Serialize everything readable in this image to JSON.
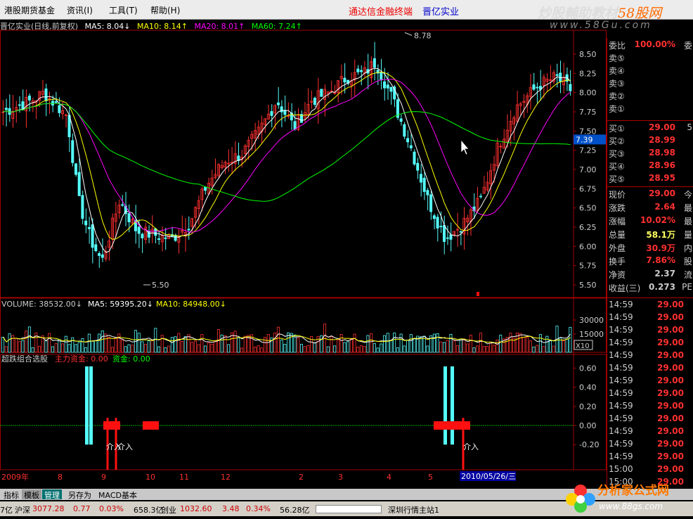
{
  "menubar": {
    "items": [
      "港股期货基金",
      "资讯(I)",
      "工具(T)",
      "帮助(H)"
    ],
    "promo": "通达信金融终端",
    "stock": "晋亿实业"
  },
  "watermark": {
    "line1_a": "炒股輔助教材",
    "line1_b": "58股网",
    "line2": "www.58Gu.com"
  },
  "price_header": {
    "name": "晋亿实业(日线,前复权)",
    "ma5": "MA5: 8.04↓",
    "ma10": "MA10: 8.14↑",
    "ma20": "MA20: 8.01↑",
    "ma60": "MA60: 7.24↑"
  },
  "price_axis": [
    "8.50",
    "8.25",
    "8.00",
    "7.75",
    "7.50",
    "7.25",
    "7.00",
    "6.75",
    "6.50",
    "6.25",
    "6.00",
    "5.75",
    "5.50"
  ],
  "current_price_tag": "7.39",
  "high_marker": "8.78",
  "low_marker": "5.50",
  "volume_header": {
    "label": "VOLUME: 38532.00↓",
    "ma5": "MA5: 59395.20↓",
    "ma10": "MA10: 84948.00↓"
  },
  "volume_axis": [
    "30000",
    "15000"
  ],
  "volume_unit": "X10",
  "indicator_header": {
    "name": "超跌组合选股",
    "f1": "主力资金: 0.00",
    "f2": "资金: 0.00"
  },
  "indicator_axis": [
    "0.60",
    "0.40",
    "0.20",
    "0.00",
    "-0.20"
  ],
  "signal_labels": [
    "介入",
    "介入",
    "介入"
  ],
  "date_axis": [
    "2009年",
    "8",
    "9",
    "10",
    "11",
    "12",
    "2",
    "3",
    "4",
    "5"
  ],
  "date_cursor": "2010/05/26/三",
  "colors": {
    "ma5": "#ffffff",
    "ma10": "#ffff00",
    "ma20": "#ff00ff",
    "ma60": "#00ff00",
    "up": "#ff3030",
    "down": "#54fcfc",
    "grid": "#a00000"
  },
  "quote_panel": {
    "sell": [
      {
        "label": "委比",
        "value": "100.00%",
        "extra": "委"
      },
      {
        "label": "卖⑤",
        "value": ""
      },
      {
        "label": "卖④",
        "value": ""
      },
      {
        "label": "卖③",
        "value": ""
      },
      {
        "label": "卖②",
        "value": ""
      },
      {
        "label": "卖①",
        "value": ""
      }
    ],
    "buy": [
      {
        "label": "买①",
        "value": "29.00",
        "qty": "5"
      },
      {
        "label": "买②",
        "value": "28.99",
        "qty": ""
      },
      {
        "label": "买③",
        "value": "28.98",
        "qty": ""
      },
      {
        "label": "买④",
        "value": "28.96",
        "qty": ""
      },
      {
        "label": "买⑤",
        "value": "28.95",
        "qty": ""
      }
    ],
    "stats": [
      {
        "label": "现价",
        "value": "29.00",
        "extra": "今"
      },
      {
        "label": "涨跌",
        "value": "2.64",
        "extra": "最"
      },
      {
        "label": "涨幅",
        "value": "10.02%",
        "extra": "最"
      },
      {
        "label": "总量",
        "value": "58.1万",
        "extra": "量"
      },
      {
        "label": "外盘",
        "value": "30.9万",
        "extra": "内"
      },
      {
        "label": "换手",
        "value": "7.86%",
        "extra": "股"
      },
      {
        "label": "净资",
        "value": "2.37",
        "extra": "流"
      },
      {
        "label": "收益(三)",
        "value": "0.273",
        "extra": "PE"
      }
    ],
    "ticks": [
      {
        "time": "14:59",
        "price": "29.00"
      },
      {
        "time": "14:59",
        "price": "29.00"
      },
      {
        "time": "14:59",
        "price": "29.00"
      },
      {
        "time": "14:59",
        "price": "29.00"
      },
      {
        "time": "14:59",
        "price": "29.00"
      },
      {
        "time": "14:59",
        "price": "29.00"
      },
      {
        "time": "14:59",
        "price": "29.00"
      },
      {
        "time": "14:59",
        "price": "29.00"
      },
      {
        "time": "14:59",
        "price": "29.00"
      },
      {
        "time": "14:59",
        "price": "29.00"
      },
      {
        "time": "14:59",
        "price": "29.00"
      },
      {
        "time": "14:59",
        "price": "29.00"
      },
      {
        "time": "14:59",
        "price": "29.00"
      },
      {
        "time": "15:00",
        "price": "29.00"
      },
      {
        "time": "15:00",
        "price": "29.00"
      }
    ]
  },
  "tabs": [
    "指标",
    "模板",
    "管理",
    "另存为",
    "MACD基本"
  ],
  "status": {
    "s1": "7亿",
    "s2": "沪深",
    "s3": "3077.28",
    "s4": "0.77",
    "s5": "0.03%",
    "s6": "658.3亿",
    "s7": "创业",
    "s8": "1032.60",
    "s9": "3.48",
    "s10": "0.34%",
    "s11": "56.28亿",
    "s12": "深圳行情主站1"
  },
  "logo": {
    "name": "分析家公式网",
    "url": "www.88gs.com"
  }
}
